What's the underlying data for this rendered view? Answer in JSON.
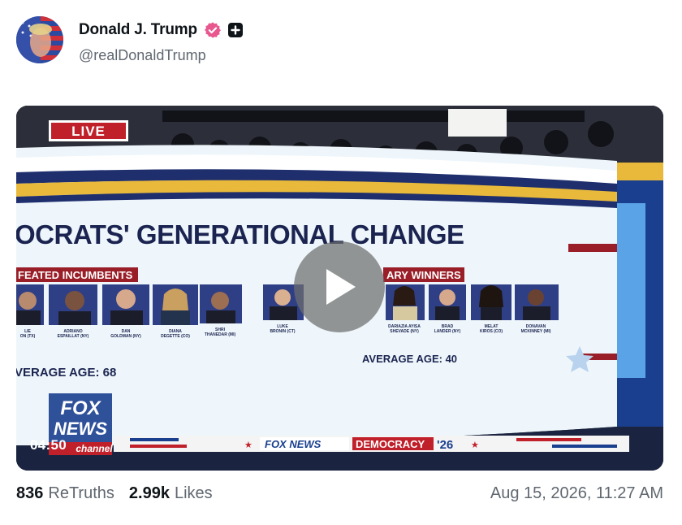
{
  "post": {
    "display_name": "Donald J. Trump",
    "handle": "@realDonaldTrump",
    "verified_icon": "verified-badge-icon",
    "plus_icon": "plus-square-icon",
    "avatar_icon": "avatar-image"
  },
  "video": {
    "time": "04:50",
    "play_icon": "play-icon",
    "live_label": "LIVE",
    "headline": "OCRATS' GENERATIONAL CHANGE",
    "left_section": "FEATED INCUMBENTS",
    "right_section": "ARY WINNERS",
    "left_average": "VERAGE AGE: 68",
    "right_average": "AVERAGE AGE: 40",
    "left_people": [
      {
        "caption": "LIE\nON (TX)"
      },
      {
        "caption": "ADRIANO\nESPAILLAT (NY)"
      },
      {
        "caption": "DAN\nGOLDMAN (NY)"
      },
      {
        "caption": "DIANA\nDEGETTE (CO)"
      },
      {
        "caption": "SHRI\nTHANEDAR (MI)"
      }
    ],
    "right_people": [
      {
        "caption": "LUKE\nBRONIN (CT)"
      },
      {
        "caption": "DARIAZIA AYISA\nSHEVADE (NY)"
      },
      {
        "caption": "BRAD\nLANDER (NY)"
      },
      {
        "caption": "MELAT\nKIROS (CO)"
      },
      {
        "caption": "DONAVAN\nMCKINNEY (MI)"
      }
    ],
    "logo_line1": "FOX",
    "logo_line2": "NEWS",
    "logo_line3": "channel",
    "ticker_brand": "FOX NEWS",
    "ticker_segment": "DEMOCRACY",
    "ticker_year": "'26"
  },
  "stats": {
    "retruths_count": "836",
    "retruths_label": "ReTruths",
    "likes_count": "2.99k",
    "likes_label": "Likes",
    "timestamp": "Aug 15, 2026, 11:27 AM"
  },
  "colors": {
    "text_primary": "#0f1419",
    "text_secondary": "#606770",
    "verified_pink": "#e8588e",
    "screen_bg": "#eef6fb",
    "banner_blue": "#1f2f6e",
    "banner_gold": "#e8b93a",
    "fox_red": "#c0202a",
    "fox_blue": "#1a3f8f"
  }
}
